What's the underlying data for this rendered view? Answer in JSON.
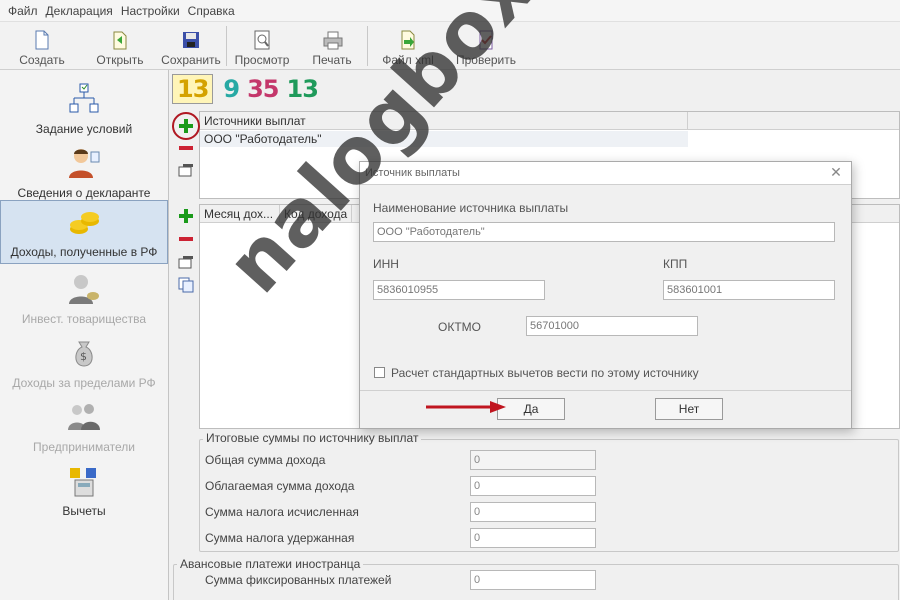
{
  "menu": [
    "Файл",
    "Декларация",
    "Настройки",
    "Справка"
  ],
  "toolbar": {
    "create": "Создать",
    "open": "Открыть",
    "save": "Сохранить",
    "preview": "Просмотр",
    "print": "Печать",
    "xml": "Файл xml",
    "check": "Проверить"
  },
  "sidebar": [
    {
      "label": "Задание условий",
      "state": "normal"
    },
    {
      "label": "Сведения о декларанте",
      "state": "normal"
    },
    {
      "label": "Доходы, полученные в РФ",
      "state": "active"
    },
    {
      "label": "Инвест. товарищества",
      "state": "disabled"
    },
    {
      "label": "Доходы за пределами РФ",
      "state": "disabled"
    },
    {
      "label": "Предприниматели",
      "state": "disabled"
    },
    {
      "label": "Вычеты",
      "state": "normal"
    }
  ],
  "page_tabs": [
    {
      "label": "13",
      "color": "#d4a200"
    },
    {
      "label": "9",
      "color": "#27a9a4"
    },
    {
      "label": "35",
      "color": "#c4376b"
    },
    {
      "label": "13",
      "color": "#1f9a5b"
    }
  ],
  "sources": {
    "header": "Источники выплат",
    "rows": [
      "ООО \"Работодатель\""
    ]
  },
  "income": {
    "col_month": "Месяц дох...",
    "col_code": "Код дохода"
  },
  "totals": {
    "title": "Итоговые суммы по источнику выплат",
    "total_income": "Общая сумма дохода",
    "taxable_income": "Облагаемая сумма дохода",
    "tax_calculated": "Сумма налога исчисленная",
    "tax_withheld": "Сумма налога удержанная",
    "v1": "0",
    "v2": "0",
    "v3": "0",
    "v4": "0"
  },
  "advance": {
    "title": "Авансовые платежи иностранца",
    "fixed_payments": "Сумма фиксированных платежей",
    "v1": "0"
  },
  "dialog": {
    "title": "Источник выплаты",
    "name_label": "Наименование источника выплаты",
    "name_value": "ООО \"Работодатель\"",
    "inn_label": "ИНН",
    "inn_value": "5836010955",
    "kpp_label": "КПП",
    "kpp_value": "583601001",
    "oktmo_label": "ОКТМО",
    "oktmo_value": "56701000",
    "checkbox_label": "Расчет стандартных вычетов вести по этому источнику",
    "yes": "Да",
    "no": "Нет"
  },
  "watermark": "nalogbox.ru",
  "colors": {
    "accent_red": "#b01822",
    "plus_green": "#1a9a1a",
    "minus_red": "#cc2233"
  }
}
